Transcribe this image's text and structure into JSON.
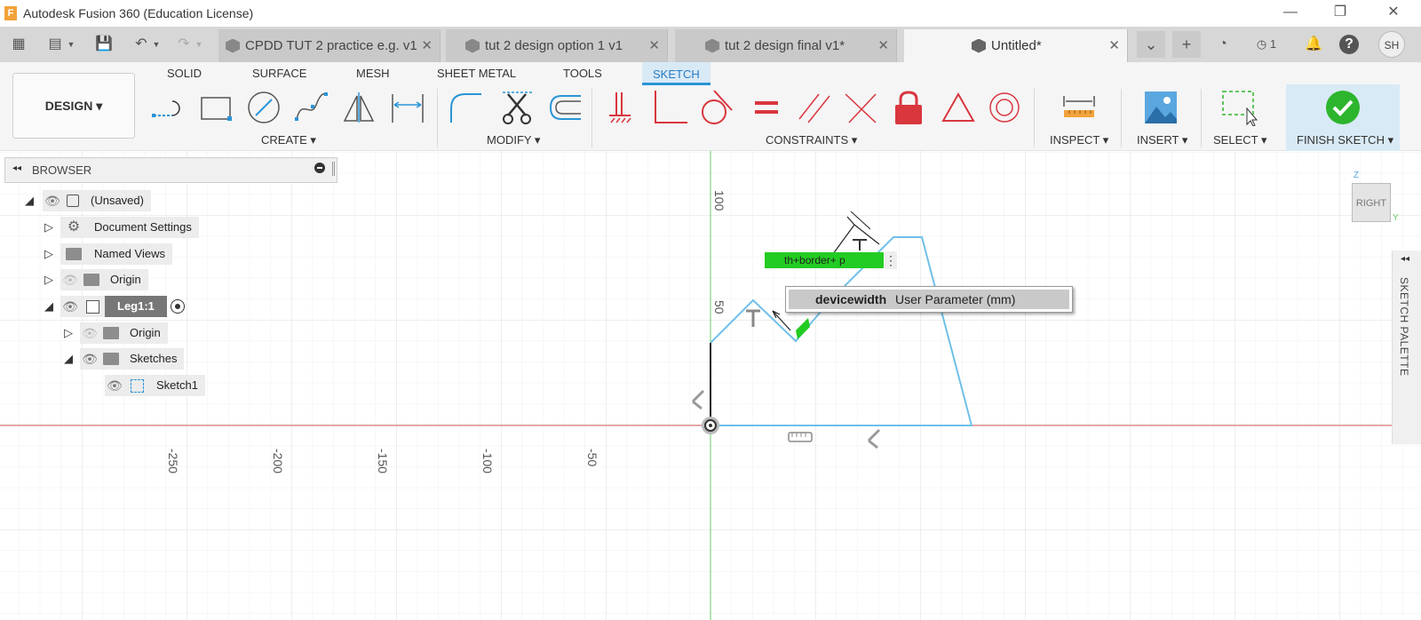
{
  "window": {
    "title": "Autodesk Fusion 360 (Education License)",
    "logo_letter": "F",
    "minimize": "—",
    "restore": "❐",
    "close": "✕"
  },
  "tabbar": {
    "grid_icon": "▦",
    "file_icon": "▤",
    "save_icon": "💾",
    "undo_icon": "↶",
    "redo_icon": "↷",
    "tabs": [
      {
        "label": "CPDD TUT 2 practice e.g. v1",
        "close": "✕"
      },
      {
        "label": "tut 2 design option 1 v1",
        "close": "✕"
      },
      {
        "label": "tut 2 design final v1*",
        "close": "✕"
      },
      {
        "label": "Untitled*",
        "close": "✕"
      }
    ],
    "overflow_icon": "⌄",
    "new_tab_icon": "+",
    "job_count": "1",
    "user_initials": "SH"
  },
  "toolbar": {
    "workspaces": [
      "SOLID",
      "SURFACE",
      "MESH",
      "SHEET METAL",
      "TOOLS",
      "SKETCH"
    ],
    "active_workspace": "SKETCH",
    "design_label": "DESIGN ▾",
    "groups": {
      "create": "CREATE ▾",
      "modify": "MODIFY ▾",
      "constraints": "CONSTRAINTS ▾",
      "inspect": "INSPECT ▾",
      "insert": "INSERT ▾",
      "select": "SELECT ▾",
      "finish": "FINISH SKETCH ▾"
    }
  },
  "browser": {
    "collapse_icon": "◂◂",
    "title": "BROWSER",
    "items": [
      {
        "label": "(Unsaved)"
      },
      {
        "label": "Document Settings"
      },
      {
        "label": "Named Views"
      },
      {
        "label": "Origin"
      },
      {
        "label": "Leg1:1"
      },
      {
        "label": "Origin"
      },
      {
        "label": "Sketches"
      },
      {
        "label": "Sketch1"
      }
    ]
  },
  "canvas": {
    "axis_labels_x": [
      "-250",
      "-200",
      "-150",
      "-100",
      "-50"
    ],
    "axis_labels_y": [
      "100",
      "50"
    ],
    "dimension_input": "th+border+ p",
    "dimension_menu": "⋮",
    "suggestion": {
      "name": "devicewidth",
      "detail": "User Parameter (mm)"
    }
  },
  "viewcube": {
    "face": "RIGHT",
    "z": "Z",
    "y": "Y"
  },
  "palette": {
    "label": "SKETCH PALETTE",
    "arrow": "◂◂"
  },
  "colors": {
    "sketch_line": "#6fc0e8",
    "x_axis": "#e06060",
    "y_axis": "#66cc66",
    "grid": "#e6e6e6",
    "accent": "#2a94d6",
    "finish_check": "#2db52d",
    "input_highlight": "#22cc22"
  }
}
